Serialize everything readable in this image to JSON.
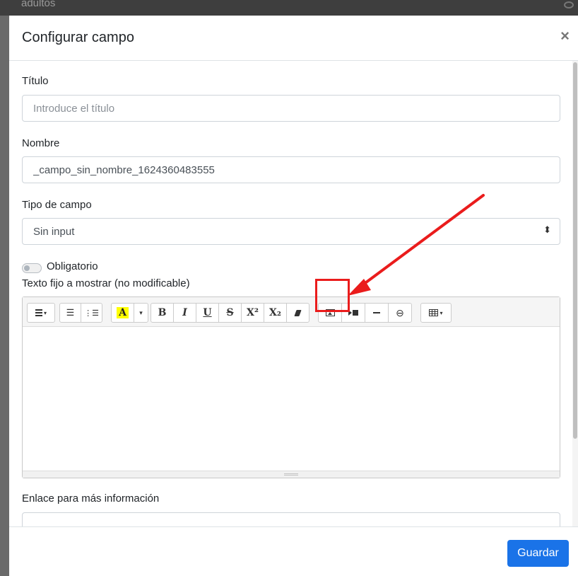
{
  "background": {
    "partial_text": "adultos"
  },
  "dialog": {
    "title": "Configurar campo",
    "close_label": "×"
  },
  "form": {
    "titulo": {
      "label": "Título",
      "value": "",
      "placeholder": "Introduce el título"
    },
    "nombre": {
      "label": "Nombre",
      "value": "_campo_sin_nombre_1624360483555",
      "placeholder": ""
    },
    "tipo": {
      "label": "Tipo de campo",
      "selected": "Sin input",
      "arrows": "⬍"
    },
    "obligatorio": {
      "label": "Obligatorio",
      "checked": false
    },
    "texto_fijo": {
      "label": "Texto fijo a mostrar (no modificable)"
    },
    "enlace": {
      "label": "Enlace para más información",
      "value": ""
    }
  },
  "toolbar": {
    "buttons": [
      {
        "name": "paragraph-align",
        "icon": "align-left-icon",
        "caret": "▾"
      },
      {
        "name": "unordered-list",
        "icon": "list-bullet-icon",
        "glyph": "☰"
      },
      {
        "name": "ordered-list",
        "icon": "list-number-icon",
        "glyph": "⋮☰"
      },
      {
        "name": "highlight-color",
        "icon": "text-highlight-icon",
        "glyph": "A"
      },
      {
        "name": "color-caret",
        "icon": "caret-down-icon",
        "glyph": "▾"
      },
      {
        "name": "bold",
        "icon": "bold-icon",
        "glyph": "B"
      },
      {
        "name": "italic",
        "icon": "italic-icon",
        "glyph": "I"
      },
      {
        "name": "underline",
        "icon": "underline-icon",
        "glyph": "U"
      },
      {
        "name": "strikethrough",
        "icon": "strikethrough-icon",
        "glyph": "S"
      },
      {
        "name": "superscript",
        "icon": "superscript-icon",
        "glyph": "X²"
      },
      {
        "name": "subscript",
        "icon": "subscript-icon",
        "glyph": "X₂"
      },
      {
        "name": "clear-format",
        "icon": "eraser-icon"
      },
      {
        "name": "insert-image",
        "icon": "picture-icon"
      },
      {
        "name": "insert-video",
        "icon": "video-icon"
      },
      {
        "name": "horizontal-rule",
        "icon": "minus-icon"
      },
      {
        "name": "insert-link",
        "icon": "link-icon",
        "glyph": "⊖"
      },
      {
        "name": "insert-table",
        "icon": "table-icon",
        "caret": "▾"
      }
    ]
  },
  "footer": {
    "save_label": "Guardar"
  },
  "annotation": {
    "color": "#ea1c1c"
  },
  "colors": {
    "primary": "#1a73e8",
    "annotation": "#ea1c1c"
  }
}
